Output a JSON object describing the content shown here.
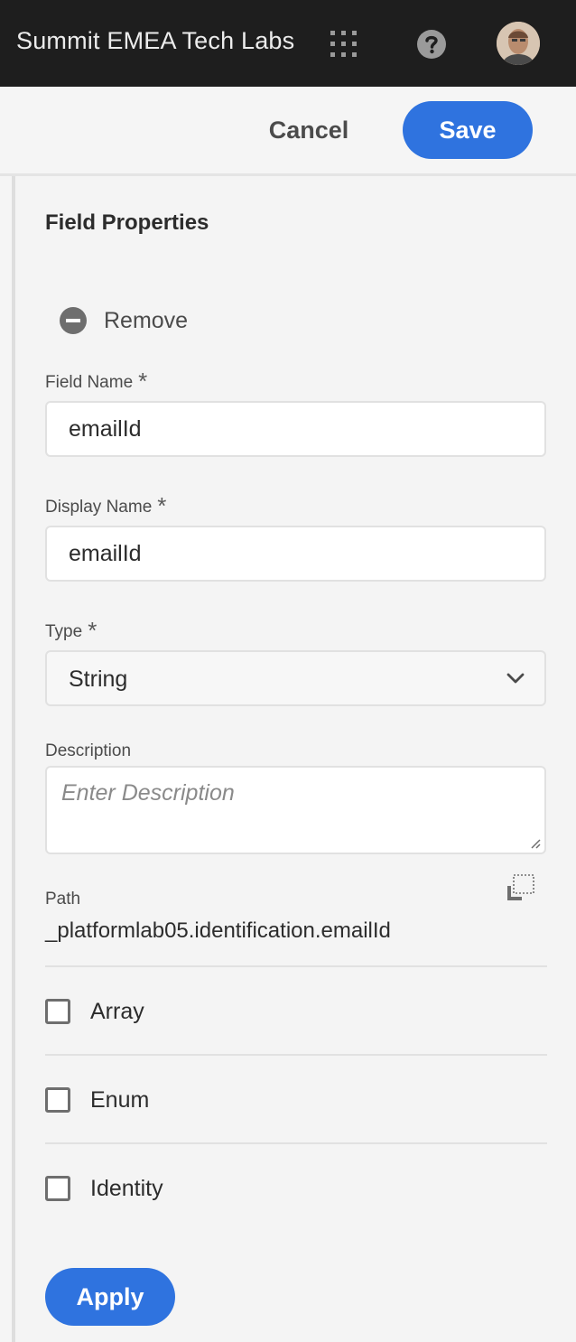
{
  "header": {
    "org_title": "Summit EMEA Tech Labs"
  },
  "actions": {
    "cancel_label": "Cancel",
    "save_label": "Save"
  },
  "panel": {
    "title": "Field Properties",
    "remove_label": "Remove",
    "field_name": {
      "label": "Field Name",
      "required": "*",
      "value": "emailId"
    },
    "display_name": {
      "label": "Display Name",
      "required": "*",
      "value": "emailId"
    },
    "type": {
      "label": "Type",
      "required": "*",
      "selected": "String"
    },
    "description": {
      "label": "Description",
      "placeholder": "Enter Description",
      "value": ""
    },
    "path": {
      "label": "Path",
      "value": "_platformlab05.identification.emailId"
    },
    "checkboxes": [
      {
        "label": "Array",
        "checked": false
      },
      {
        "label": "Enum",
        "checked": false
      },
      {
        "label": "Identity",
        "checked": false
      }
    ],
    "apply_label": "Apply"
  },
  "colors": {
    "primary": "#2f73df",
    "topbar": "#1e1e1e",
    "panel_bg": "#f4f4f4"
  },
  "icons": [
    "apps-grid-icon",
    "help-icon",
    "remove-icon",
    "chevron-down-icon",
    "copy-icon",
    "resize-grip-icon"
  ]
}
